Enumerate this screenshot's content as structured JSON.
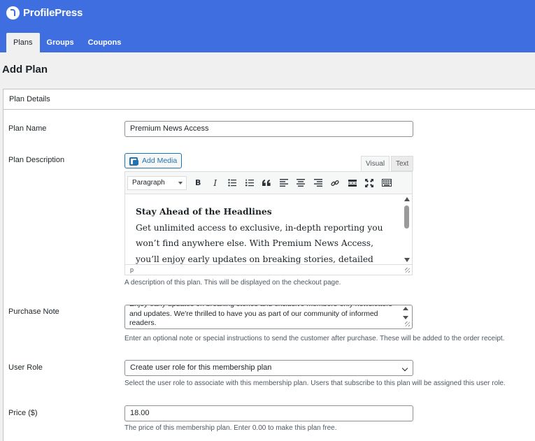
{
  "brand": {
    "name": "ProfilePress",
    "color": "#3e6ee0"
  },
  "tabs": [
    {
      "label": "Plans",
      "active": true
    },
    {
      "label": "Groups",
      "active": false
    },
    {
      "label": "Coupons",
      "active": false
    }
  ],
  "page": {
    "title": "Add Plan"
  },
  "panel": {
    "title": "Plan Details"
  },
  "plan_name": {
    "label": "Plan Name",
    "value": "Premium News Access"
  },
  "plan_description": {
    "label": "Plan Description",
    "add_media_label": "Add Media",
    "tab_visual": "Visual",
    "tab_text": "Text",
    "format_value": "Paragraph",
    "heading": "Stay Ahead of the Headlines",
    "body": "Get unlimited access to exclusive, in-depth reporting you won’t find anywhere else. With Premium News Access, you’ll enjoy early updates on breaking stories, detailed investigative reports, expert",
    "status_path": "p",
    "hint": "A description of this plan. This will be displayed on the checkout page."
  },
  "purchase_note": {
    "label": "Purchase Note",
    "value": "Enjoy early updates on breaking stories and exclusive members-only newsletters and updates. We're thrilled to have you as part of our community of informed readers.",
    "hint": "Enter an optional note or special instructions to send the customer after purchase. These will be added to the order receipt."
  },
  "user_role": {
    "label": "User Role",
    "value": "Create user role for this membership plan",
    "hint": "Select the user role to associate with this membership plan. Users that subscribe to this plan will be assigned this user role."
  },
  "price": {
    "label": "Price ($)",
    "value": "18.00",
    "hint": "The price of this membership plan. Enter 0.00 to make this plan free."
  },
  "icons": {
    "logo": "profilepress-logo-icon",
    "add_media": "media-icon",
    "toolbar": [
      "bold-icon",
      "italic-icon",
      "bulleted-list-icon",
      "numbered-list-icon",
      "blockquote-icon",
      "align-left-icon",
      "align-center-icon",
      "align-right-icon",
      "link-icon",
      "read-more-icon",
      "fullscreen-icon",
      "toolbar-toggle-icon"
    ]
  }
}
